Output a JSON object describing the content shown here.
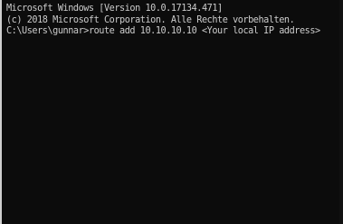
{
  "console": {
    "header_line_1": "Microsoft Windows [Version 10.0.17134.471]",
    "header_line_2": "(c) 2018 Microsoft Corporation. Alle Rechte vorbehalten.",
    "prompt_path": "C:\\Users\\gunnar>",
    "command": "route add 10.10.10.10 <Your local IP address>",
    "colors": {
      "background": "#0c0c0c",
      "text": "#cccccc"
    }
  }
}
